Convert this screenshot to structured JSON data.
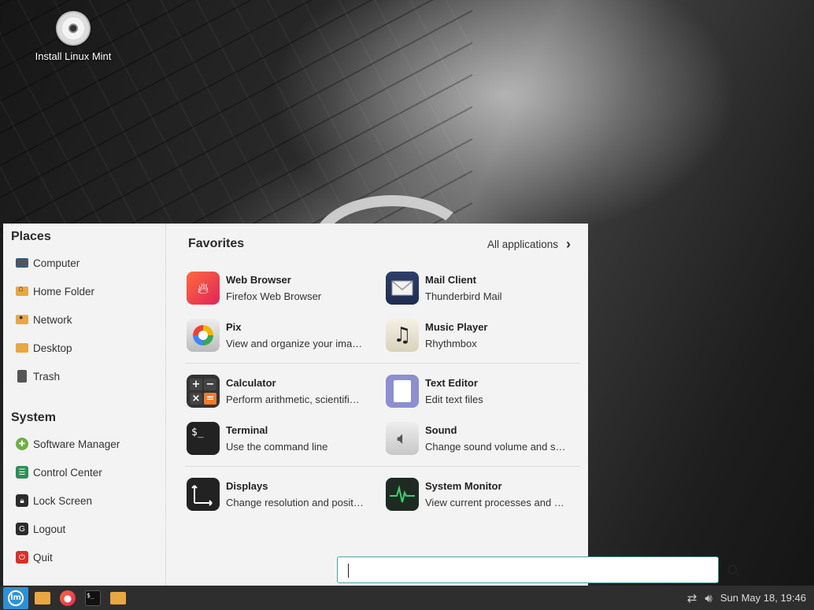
{
  "desktop": {
    "icons": [
      {
        "label": "Install Linux Mint",
        "icon": "disc-icon"
      }
    ]
  },
  "menu": {
    "places": {
      "title": "Places",
      "items": [
        {
          "label": "Computer",
          "icon": "computer-icon"
        },
        {
          "label": "Home Folder",
          "icon": "home-folder-icon"
        },
        {
          "label": "Network",
          "icon": "network-folder-icon"
        },
        {
          "label": "Desktop",
          "icon": "desktop-folder-icon"
        },
        {
          "label": "Trash",
          "icon": "trash-icon"
        }
      ]
    },
    "system": {
      "title": "System",
      "items": [
        {
          "label": "Software Manager",
          "icon": "software-manager-icon"
        },
        {
          "label": "Control Center",
          "icon": "control-center-icon"
        },
        {
          "label": "Lock Screen",
          "icon": "lock-icon"
        },
        {
          "label": "Logout",
          "icon": "logout-icon"
        },
        {
          "label": "Quit",
          "icon": "power-icon"
        }
      ]
    },
    "favorites": {
      "title": "Favorites",
      "all_applications": "All applications",
      "apps": [
        {
          "name": "Web Browser",
          "desc": "Firefox Web Browser",
          "icon": "firefox-icon"
        },
        {
          "name": "Mail Client",
          "desc": "Thunderbird Mail",
          "icon": "mail-icon"
        },
        {
          "name": "Pix",
          "desc": "View and organize your ima…",
          "icon": "pix-icon"
        },
        {
          "name": "Music Player",
          "desc": "Rhythmbox",
          "icon": "music-note-icon"
        },
        {
          "name": "Calculator",
          "desc": "Perform arithmetic, scientifi…",
          "icon": "calculator-icon"
        },
        {
          "name": "Text Editor",
          "desc": "Edit text files",
          "icon": "text-editor-icon"
        },
        {
          "name": "Terminal",
          "desc": "Use the command line",
          "icon": "terminal-icon"
        },
        {
          "name": "Sound",
          "desc": "Change sound volume and s…",
          "icon": "speaker-icon"
        },
        {
          "name": "Displays",
          "desc": "Change resolution and posit…",
          "icon": "displays-icon"
        },
        {
          "name": "System Monitor",
          "desc": "View current processes and …",
          "icon": "system-monitor-icon"
        }
      ]
    },
    "search": {
      "value": "",
      "placeholder": ""
    }
  },
  "taskbar": {
    "launchers": [
      "mint-menu-icon",
      "folder-icon",
      "firefox-icon",
      "terminal-icon",
      "folder-icon"
    ],
    "clock": "Sun May 18, 19:46",
    "colors": {
      "accent": "#2f8fd6",
      "panel": "#2e2e2e"
    }
  }
}
